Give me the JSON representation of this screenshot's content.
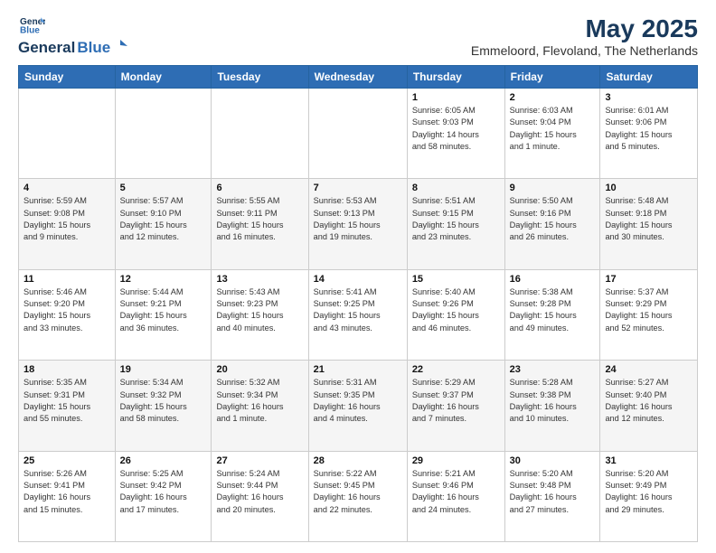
{
  "header": {
    "logo_line1": "General",
    "logo_line2": "Blue",
    "main_title": "May 2025",
    "subtitle": "Emmeloord, Flevoland, The Netherlands"
  },
  "weekdays": [
    "Sunday",
    "Monday",
    "Tuesday",
    "Wednesday",
    "Thursday",
    "Friday",
    "Saturday"
  ],
  "weeks": [
    [
      {
        "day": "",
        "info": ""
      },
      {
        "day": "",
        "info": ""
      },
      {
        "day": "",
        "info": ""
      },
      {
        "day": "",
        "info": ""
      },
      {
        "day": "1",
        "info": "Sunrise: 6:05 AM\nSunset: 9:03 PM\nDaylight: 14 hours\nand 58 minutes."
      },
      {
        "day": "2",
        "info": "Sunrise: 6:03 AM\nSunset: 9:04 PM\nDaylight: 15 hours\nand 1 minute."
      },
      {
        "day": "3",
        "info": "Sunrise: 6:01 AM\nSunset: 9:06 PM\nDaylight: 15 hours\nand 5 minutes."
      }
    ],
    [
      {
        "day": "4",
        "info": "Sunrise: 5:59 AM\nSunset: 9:08 PM\nDaylight: 15 hours\nand 9 minutes."
      },
      {
        "day": "5",
        "info": "Sunrise: 5:57 AM\nSunset: 9:10 PM\nDaylight: 15 hours\nand 12 minutes."
      },
      {
        "day": "6",
        "info": "Sunrise: 5:55 AM\nSunset: 9:11 PM\nDaylight: 15 hours\nand 16 minutes."
      },
      {
        "day": "7",
        "info": "Sunrise: 5:53 AM\nSunset: 9:13 PM\nDaylight: 15 hours\nand 19 minutes."
      },
      {
        "day": "8",
        "info": "Sunrise: 5:51 AM\nSunset: 9:15 PM\nDaylight: 15 hours\nand 23 minutes."
      },
      {
        "day": "9",
        "info": "Sunrise: 5:50 AM\nSunset: 9:16 PM\nDaylight: 15 hours\nand 26 minutes."
      },
      {
        "day": "10",
        "info": "Sunrise: 5:48 AM\nSunset: 9:18 PM\nDaylight: 15 hours\nand 30 minutes."
      }
    ],
    [
      {
        "day": "11",
        "info": "Sunrise: 5:46 AM\nSunset: 9:20 PM\nDaylight: 15 hours\nand 33 minutes."
      },
      {
        "day": "12",
        "info": "Sunrise: 5:44 AM\nSunset: 9:21 PM\nDaylight: 15 hours\nand 36 minutes."
      },
      {
        "day": "13",
        "info": "Sunrise: 5:43 AM\nSunset: 9:23 PM\nDaylight: 15 hours\nand 40 minutes."
      },
      {
        "day": "14",
        "info": "Sunrise: 5:41 AM\nSunset: 9:25 PM\nDaylight: 15 hours\nand 43 minutes."
      },
      {
        "day": "15",
        "info": "Sunrise: 5:40 AM\nSunset: 9:26 PM\nDaylight: 15 hours\nand 46 minutes."
      },
      {
        "day": "16",
        "info": "Sunrise: 5:38 AM\nSunset: 9:28 PM\nDaylight: 15 hours\nand 49 minutes."
      },
      {
        "day": "17",
        "info": "Sunrise: 5:37 AM\nSunset: 9:29 PM\nDaylight: 15 hours\nand 52 minutes."
      }
    ],
    [
      {
        "day": "18",
        "info": "Sunrise: 5:35 AM\nSunset: 9:31 PM\nDaylight: 15 hours\nand 55 minutes."
      },
      {
        "day": "19",
        "info": "Sunrise: 5:34 AM\nSunset: 9:32 PM\nDaylight: 15 hours\nand 58 minutes."
      },
      {
        "day": "20",
        "info": "Sunrise: 5:32 AM\nSunset: 9:34 PM\nDaylight: 16 hours\nand 1 minute."
      },
      {
        "day": "21",
        "info": "Sunrise: 5:31 AM\nSunset: 9:35 PM\nDaylight: 16 hours\nand 4 minutes."
      },
      {
        "day": "22",
        "info": "Sunrise: 5:29 AM\nSunset: 9:37 PM\nDaylight: 16 hours\nand 7 minutes."
      },
      {
        "day": "23",
        "info": "Sunrise: 5:28 AM\nSunset: 9:38 PM\nDaylight: 16 hours\nand 10 minutes."
      },
      {
        "day": "24",
        "info": "Sunrise: 5:27 AM\nSunset: 9:40 PM\nDaylight: 16 hours\nand 12 minutes."
      }
    ],
    [
      {
        "day": "25",
        "info": "Sunrise: 5:26 AM\nSunset: 9:41 PM\nDaylight: 16 hours\nand 15 minutes."
      },
      {
        "day": "26",
        "info": "Sunrise: 5:25 AM\nSunset: 9:42 PM\nDaylight: 16 hours\nand 17 minutes."
      },
      {
        "day": "27",
        "info": "Sunrise: 5:24 AM\nSunset: 9:44 PM\nDaylight: 16 hours\nand 20 minutes."
      },
      {
        "day": "28",
        "info": "Sunrise: 5:22 AM\nSunset: 9:45 PM\nDaylight: 16 hours\nand 22 minutes."
      },
      {
        "day": "29",
        "info": "Sunrise: 5:21 AM\nSunset: 9:46 PM\nDaylight: 16 hours\nand 24 minutes."
      },
      {
        "day": "30",
        "info": "Sunrise: 5:20 AM\nSunset: 9:48 PM\nDaylight: 16 hours\nand 27 minutes."
      },
      {
        "day": "31",
        "info": "Sunrise: 5:20 AM\nSunset: 9:49 PM\nDaylight: 16 hours\nand 29 minutes."
      }
    ]
  ]
}
